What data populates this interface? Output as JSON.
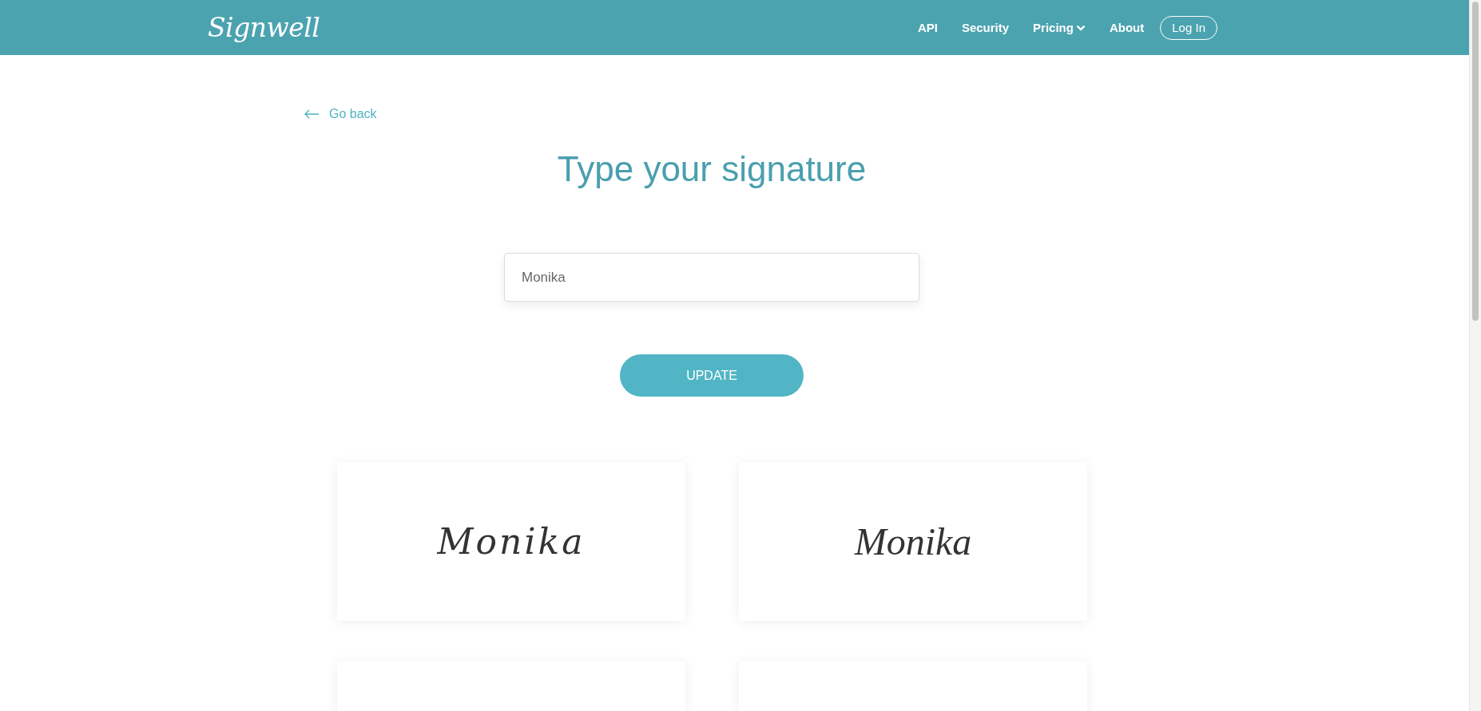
{
  "header": {
    "logo": "Signwell",
    "nav": [
      {
        "label": "API",
        "dropdown": false
      },
      {
        "label": "Security",
        "dropdown": false
      },
      {
        "label": "Pricing",
        "dropdown": true
      },
      {
        "label": "About",
        "dropdown": false
      }
    ],
    "login_button": "Log In"
  },
  "back_link": "Go back",
  "title": "Type your signature",
  "name_field": {
    "value": "Monika"
  },
  "update_button": "UPDATE",
  "signature_options": [
    {
      "kind": "signature",
      "text": "Monika"
    },
    {
      "kind": "signature",
      "text": "Monika"
    },
    {
      "kind": "cut-off"
    },
    {
      "kind": "cut-off"
    }
  ]
}
